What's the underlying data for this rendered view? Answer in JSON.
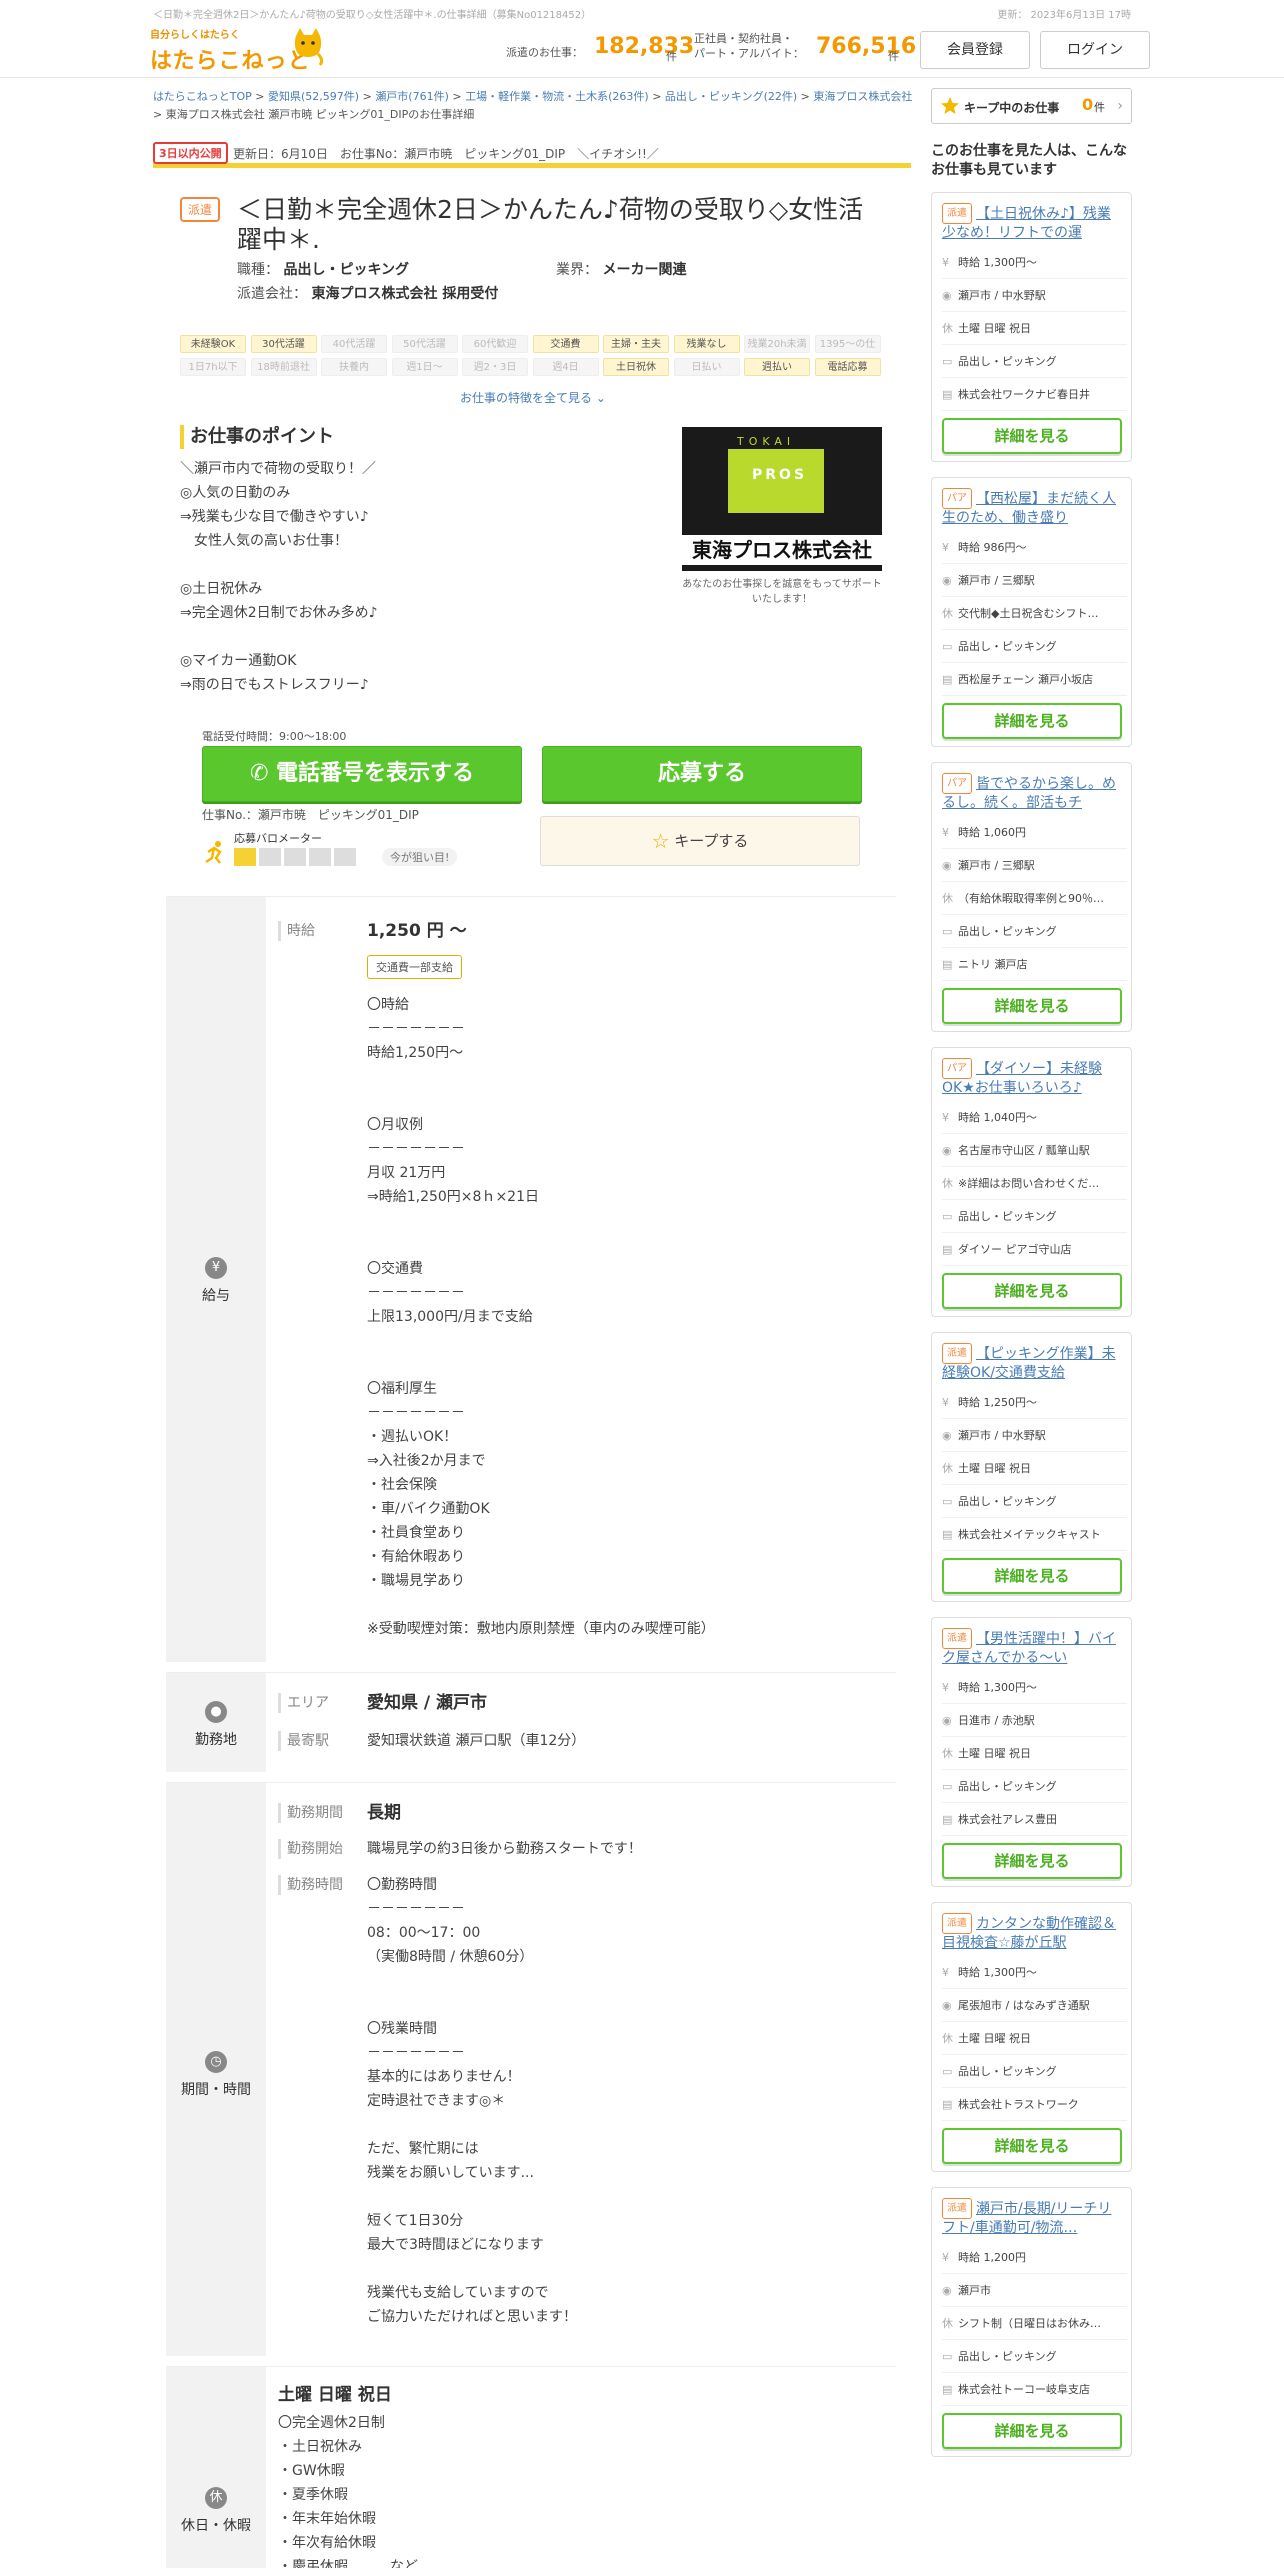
{
  "top": {
    "crumb_title": "＜日勤＊完全週休2日＞かんたん♪荷物の受取り◇女性活躍中＊.の仕事詳細（募集No01218452）",
    "updated": "更新： 2023年6月13日 17時"
  },
  "header": {
    "tagline": "自分らしくはたらく",
    "logo": "はたらこねっと",
    "haken_label": "派遣のお仕事：",
    "haken_count": "182,833",
    "haken_unit": "件",
    "other_label1": "正社員・契約社員・",
    "other_label2": "パート・アルバイト：",
    "other_count": "766,516",
    "other_unit": "件",
    "register": "会員登録",
    "login": "ログイン"
  },
  "breadcrumb": [
    "はたらこねっとTOP",
    ">",
    "愛知県(52,597件)",
    ">",
    "瀬戸市(761件)",
    ">",
    "工場・軽作業・物流・土木系(263件)",
    ">",
    "品出し・ピッキング(22件)",
    ">",
    "東海プロス株式会社",
    ">",
    "東海プロス株式会社 瀬戸市暁 ピッキング01_DIPのお仕事詳細"
  ],
  "update": {
    "badge": "3日以内公開",
    "text": "更新日：6月10日　お仕事No：瀬戸市暁　ピッキング01_DIP　＼イチオシ!!／"
  },
  "job": {
    "type": "派遣",
    "title": "＜日勤＊完全週休2日＞かんたん♪荷物の受取り◇女性活躍中＊.",
    "occ_label": "職種：",
    "occ": "品出し・ピッキング",
    "ind_label": "業界：",
    "ind": "メーカー関連",
    "agency_label": "派遣会社：",
    "agency": "東海プロス株式会社 採用受付"
  },
  "tags_row1": [
    [
      "未経験OK",
      1
    ],
    [
      "30代活躍",
      1
    ],
    [
      "40代活躍",
      0
    ],
    [
      "50代活躍",
      0
    ],
    [
      "60代歓迎",
      0
    ],
    [
      "交通費",
      1
    ],
    [
      "主婦・主夫",
      1
    ],
    [
      "残業なし",
      1
    ],
    [
      "残業20h未満",
      0
    ],
    [
      "1395～の仕",
      0
    ]
  ],
  "tags_row2": [
    [
      "1日7h以下",
      0
    ],
    [
      "18時前退社",
      0
    ],
    [
      "扶養内",
      0
    ],
    [
      "週1日～",
      0
    ],
    [
      "週2・3日",
      0
    ],
    [
      "週4日",
      0
    ],
    [
      "土日祝休",
      1
    ],
    [
      "日払い",
      0
    ],
    [
      "週払い",
      1
    ],
    [
      "電話応募",
      1
    ]
  ],
  "all_features": "お仕事の特徴を全て見る ⌄",
  "points": {
    "heading": "お仕事のポイント",
    "body": "＼瀬戸市内で荷物の受取り！／\n◎人気の日勤のみ\n⇒残業も少な目で働きやすい♪\n　女性人気の高いお仕事！\n\n◎土日祝休み\n⇒完全週休2日制でお休み多め♪\n\n◎マイカー通勤OK\n⇒雨の日でもストレスフリー♪"
  },
  "company_logo": {
    "top": "TOKAI",
    "mid": "PROS",
    "name": "東海プロス株式会社",
    "caption": "あなたのお仕事探しを誠意をもってサポートいたします！"
  },
  "actions": {
    "hours": "電話受付時間：9:00～18:00",
    "phone": "電話番号を表示する",
    "apply": "応募する",
    "jobno": "仕事No.：瀬戸市暁　ピッキング01_DIP",
    "barometer": "応募バロメーター",
    "barometer_level": 1,
    "barometer_chip": "今が狙い目!",
    "keep": "キープする"
  },
  "salary": {
    "label": "給与",
    "sub": "時給",
    "amount": "1,250 円 ～",
    "chip": "交通費一部支給",
    "body": "〇時給\n－－－－－－－\n時給1,250円～\n\n\n〇月収例\n－－－－－－－\n月収 21万円\n⇒時給1,250円×8ｈ×21日\n\n\n〇交通費\n－－－－－－－\n上限13,000円/月まで支給\n\n\n〇福利厚生\n－－－－－－－\n・週払いOK！\n⇒入社後2か月まで\n・社会保険\n・車/バイク通勤OK\n・社員食堂あり\n・有給休暇あり\n・職場見学あり\n\n※受動喫煙対策：敷地内原則禁煙（車内のみ喫煙可能）"
  },
  "location": {
    "label": "勤務地",
    "area_label": "エリア",
    "area": "愛知県 / 瀬戸市",
    "st_label": "最寄駅",
    "st": "愛知環状鉄道 瀬戸口駅（車12分）"
  },
  "period": {
    "label": "期間・時間",
    "p_label": "勤務期間",
    "p": "長期",
    "s_label": "勤務開始",
    "s": "職場見学の約3日後から勤務スタートです！",
    "h_label": "勤務時間",
    "h": "〇勤務時間\n－－－－－－－\n08：00～17：00\n（実働8時間 / 休憩60分）\n\n\n〇残業時間\n－－－－－－－\n基本的にはありません！\n定時退社できます◎＊\n\nただ、繁忙期には\n残業をお願いしています...\n\n短くて1日30分\n最大で3時間ほどになります\n\n残業代も支給していますので\nご協力いただければと思います！"
  },
  "holiday": {
    "label": "休日・休暇",
    "title": "土曜 日曜 祝日",
    "body": "〇完全週休2日制\n・土日祝休み\n・GW休暇\n・夏季休暇\n・年末年始休暇\n・年次有給休暇\n・慶弔休暇　　　など"
  },
  "sidebar": {
    "keep_label": "キープ中のお仕事",
    "keep_count": "0",
    "keep_unit": "件",
    "title": "このお仕事を見た人は、こんなお仕事も見ています",
    "detail": "詳細を見る",
    "cards": [
      {
        "type": "派遣",
        "title": "【土日祝休み♪】残業少なめ！リフトでの運",
        "pay": "時給 1,300円～",
        "place": "瀬戸市 / 中水野駅",
        "hol": "土曜 日曜 祝日",
        "job": "品出し・ピッキング",
        "co": "株式会社ワークナビ春日井"
      },
      {
        "type": "パア",
        "title": "【西松屋】まだ続く人生のため、働き盛り",
        "pay": "時給 986円～",
        "place": "瀬戸市 / 三郷駅",
        "hol": "交代制◆土日祝含むシフト…",
        "job": "品出し・ピッキング",
        "co": "西松屋チェーン 瀬戸小坂店"
      },
      {
        "type": "パア",
        "title": "皆でやるから楽し。めるし。続く。部活もチ",
        "pay": "時給 1,060円",
        "place": "瀬戸市 / 三郷駅",
        "hol": "（有給休暇取得率例と90％…",
        "job": "品出し・ピッキング",
        "co": "ニトリ 瀬戸店"
      },
      {
        "type": "パア",
        "title": "【ダイソー】未経験OK★お仕事いろいろ♪",
        "pay": "時給 1,040円～",
        "place": "名古屋市守山区 / 瓢箪山駅",
        "hol": "※詳細はお問い合わせくだ…",
        "job": "品出し・ピッキング",
        "co": "ダイソー ピアゴ守山店"
      },
      {
        "type": "派遣",
        "title": "【ピッキング作業】未経験OK/交通費支給",
        "pay": "時給 1,250円～",
        "place": "瀬戸市 / 中水野駅",
        "hol": "土曜 日曜 祝日",
        "job": "品出し・ピッキング",
        "co": "株式会社メイテックキャスト"
      },
      {
        "type": "派遣",
        "title": "【男性活躍中！】バイク屋さんでかる～い",
        "pay": "時給 1,300円～",
        "place": "日進市 / 赤池駅",
        "hol": "土曜 日曜 祝日",
        "job": "品出し・ピッキング",
        "co": "株式会社アレス豊田"
      },
      {
        "type": "派遣",
        "title": "カンタンな動作確認＆目視検査☆藤が丘駅",
        "pay": "時給 1,300円～",
        "place": "尾張旭市 / はなみずき通駅",
        "hol": "土曜 日曜 祝日",
        "job": "品出し・ピッキング",
        "co": "株式会社トラストワーク"
      },
      {
        "type": "派遣",
        "title": "瀬戸市/長期/リーチリフト/車通勤可/物流…",
        "pay": "時給 1,200円",
        "place": "瀬戸市",
        "hol": "シフト制（日曜日はお休み…",
        "job": "品出し・ピッキング",
        "co": "株式会社トーコー岐阜支店"
      }
    ]
  }
}
